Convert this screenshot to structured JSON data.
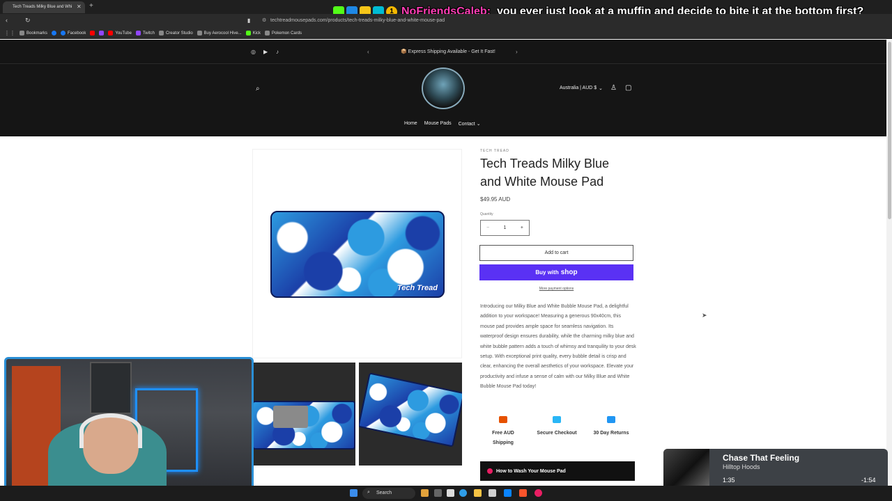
{
  "browser": {
    "tab_title": "Tech Treads Milky Blue and Whi",
    "url": "techtreadmousepads.com/products/tech-treads-milky-blue-and-white-mouse-pad",
    "bookmarks": [
      "Bookmarks",
      "Facebook",
      "YouTube",
      "Twitch",
      "Creator Studio",
      "Buy Aerocool Hive...",
      "Kick",
      "Pokemon Cards"
    ]
  },
  "chat": {
    "badge_count": "1",
    "username": "NoFriendsCaleb:",
    "message": "you ever just look at a muffin and decide to bite it at the bottom first?"
  },
  "site": {
    "announcement": "📦 Express Shipping Available - Get It Fast!",
    "region": "Australia | AUD $",
    "nav": [
      "Home",
      "Mouse Pads",
      "Contact"
    ]
  },
  "product": {
    "vendor": "TECH TREAD",
    "title": "Tech Treads Milky Blue and White Mouse Pad",
    "price": "$49.95 AUD",
    "quantity_label": "Quantity",
    "quantity": "1",
    "add_to_cart": "Add to cart",
    "buy_with": "Buy with",
    "shop": "shop",
    "more_payment": "More payment options",
    "description": "Introducing our Milky Blue and White Bubble Mouse Pad, a delightful addition to your workspace! Measuring a generous 90x40cm, this mouse pad provides ample space for seamless navigation. Its waterproof design ensures durability, while the charming milky blue and white bubble pattern adds a touch of whimsy and tranquility to your desk setup. With exceptional print quality, every bubble detail is crisp and clear, enhancing the overall aesthetics of your workspace. Elevate your productivity and infuse a sense of calm with our Milky Blue and White Bubble Mouse Pad today!",
    "features": [
      "Free AUD Shipping",
      "Secure Checkout",
      "30 Day Returns"
    ],
    "wash_button": "How to Wash Your Mouse Pad",
    "pad_logo_text": "Tech Tread"
  },
  "music": {
    "song": "Chase That Feeling",
    "artist": "Hilltop Hoods",
    "elapsed": "1:35",
    "remaining": "-1:54",
    "progress": 0.47
  },
  "taskbar": {
    "search": "Search"
  },
  "colors": {
    "shop_purple": "#5a31f4",
    "header_bg": "#151515",
    "webcam_border": "#2a8fd6"
  }
}
